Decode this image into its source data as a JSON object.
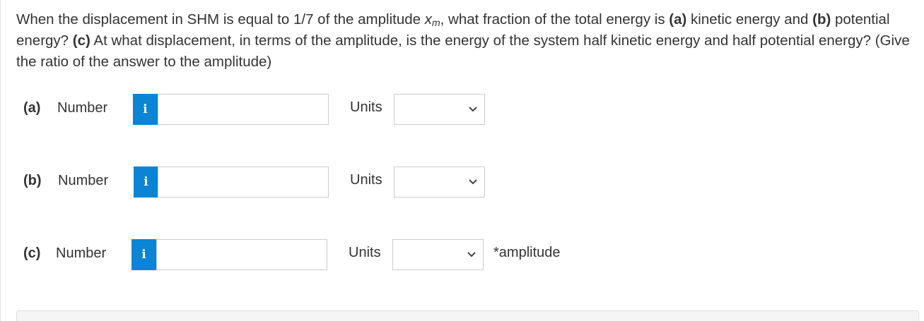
{
  "question": {
    "part1": "When the displacement in SHM is equal to 1/7 of the amplitude ",
    "var_main": "x",
    "var_sub": "m",
    "part2": ", what fraction of the total energy is ",
    "bold_a": "(a)",
    "part3": " kinetic energy and ",
    "bold_b": "(b)",
    "part4": " potential energy? ",
    "bold_c": "(c)",
    "part5": " At what displacement, in terms of the amplitude, is the energy of the system half kinetic energy and half potential energy? (Give the ratio of the answer to the amplitude)"
  },
  "rows": [
    {
      "part": "(a)",
      "number_label": "Number",
      "info_icon": "info-icon",
      "info_glyph": "i",
      "input_value": "",
      "units_label": "Units",
      "units_selected": "",
      "suffix": ""
    },
    {
      "part": "(b)",
      "number_label": "Number",
      "info_icon": "info-icon",
      "info_glyph": "i",
      "input_value": "",
      "units_label": "Units",
      "units_selected": "",
      "suffix": ""
    },
    {
      "part": "(c)",
      "number_label": "Number",
      "info_icon": "info-icon",
      "info_glyph": "i",
      "input_value": "",
      "units_label": "Units",
      "units_selected": "",
      "suffix": "*amplitude"
    }
  ],
  "colors": {
    "info_button": "#0a84d4",
    "text": "#333333",
    "border": "#cccccc"
  }
}
